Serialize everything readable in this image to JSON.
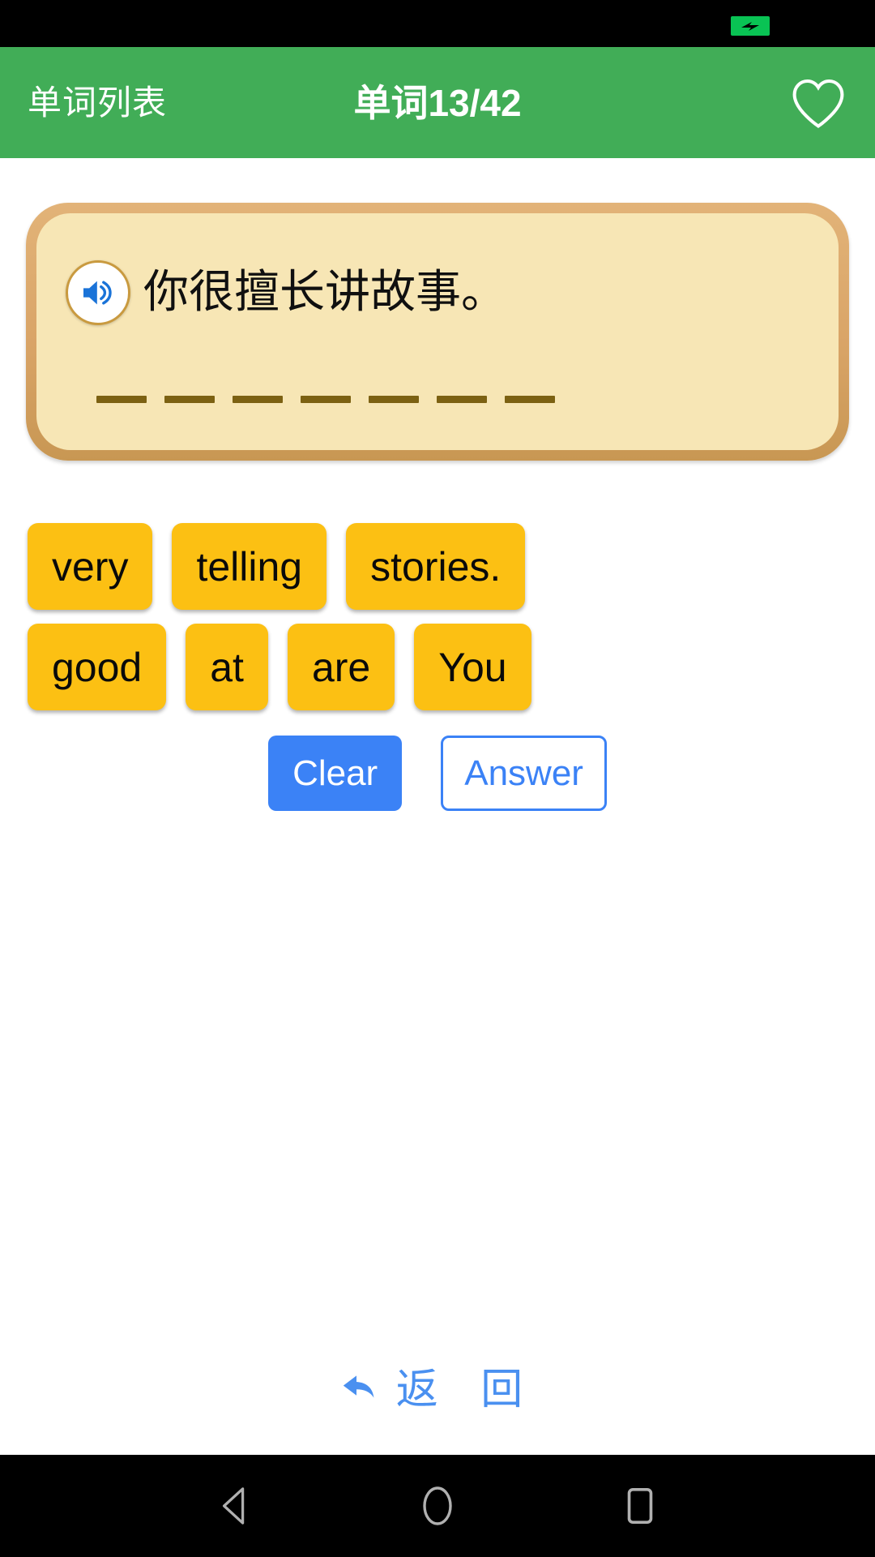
{
  "status_bar": {
    "battery_icon": "battery-charging-icon",
    "battery_color": "#09c354"
  },
  "app_bar": {
    "back_label": "单词列表",
    "title": "单词13/42",
    "favorite_icon": "heart-outline-icon",
    "background_color": "#41ad57",
    "text_color": "#ffffff"
  },
  "card": {
    "speaker_icon": "speaker-icon",
    "sentence": "你很擅长讲故事。",
    "blank_count": 7,
    "border_color": "#d9a467",
    "fill_color": "#f7e6b5",
    "dash_color": "#7c6112"
  },
  "tiles": {
    "color": "#fcc013",
    "rows": [
      [
        "very",
        "telling",
        "stories."
      ],
      [
        "good",
        "at",
        "are",
        "You"
      ]
    ]
  },
  "actions": {
    "clear_label": "Clear",
    "answer_label": "Answer",
    "accent_color": "#3b82f6"
  },
  "back_link": {
    "icon": "back-arrow-icon",
    "label": "返 回",
    "color": "#4a90f0"
  },
  "nav_bar": {
    "back_icon": "triangle-back-icon",
    "home_icon": "circle-home-icon",
    "recents_icon": "square-recents-icon"
  }
}
